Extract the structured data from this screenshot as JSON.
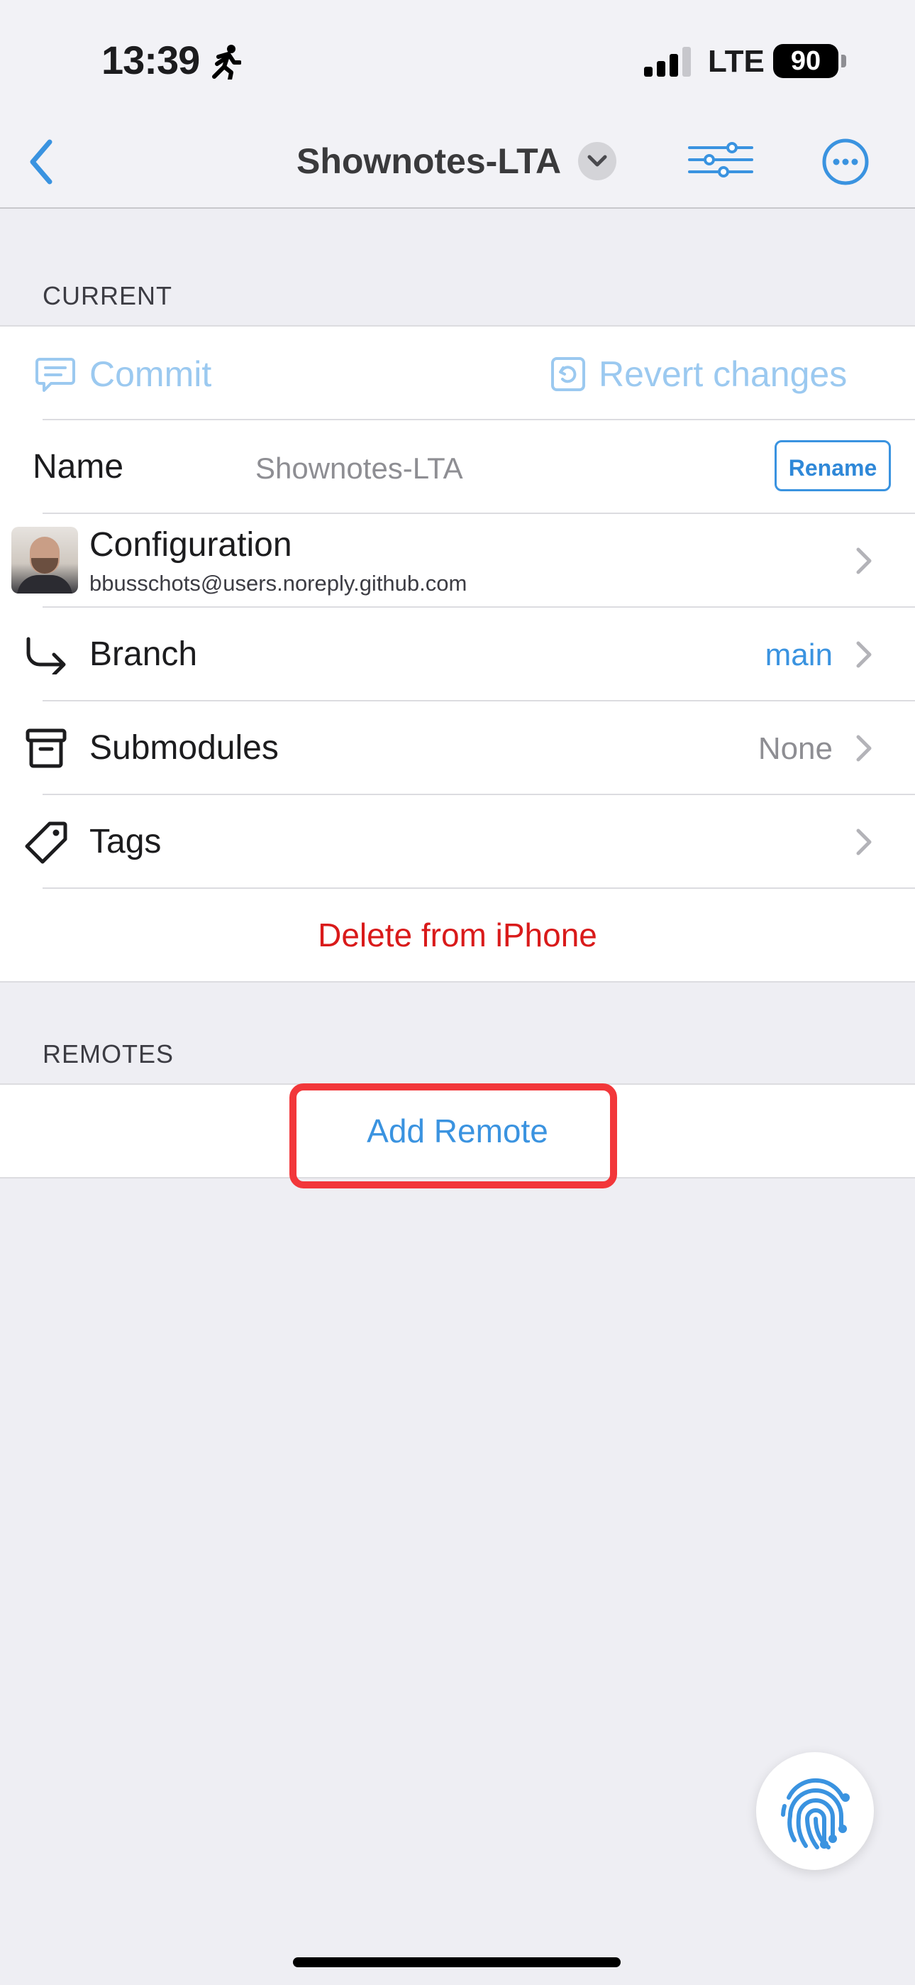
{
  "status_bar": {
    "time": "13:39",
    "network": "LTE",
    "battery": "90"
  },
  "navbar": {
    "title": "Shownotes-LTA",
    "icons": [
      "back-icon",
      "chevron-down-icon",
      "filter-icon",
      "more-icon"
    ]
  },
  "current": {
    "header": "CURRENT",
    "commit_label": "Commit",
    "revert_label": "Revert changes",
    "name_label": "Name",
    "name_value": "Shownotes-LTA",
    "rename_label": "Rename",
    "configuration_label": "Configuration",
    "configuration_email": "bbusschots@users.noreply.github.com",
    "branch_label": "Branch",
    "branch_value": "main",
    "submodules_label": "Submodules",
    "submodules_value": "None",
    "tags_label": "Tags",
    "delete_label": "Delete from iPhone"
  },
  "remotes": {
    "header": "REMOTES",
    "add_remote_label": "Add Remote"
  },
  "colors": {
    "accent": "#3a93e0",
    "accent_disabled": "#9bc9f0",
    "destructive": "#d91a1a",
    "highlight": "#f2373a",
    "background": "#eeeef3"
  }
}
